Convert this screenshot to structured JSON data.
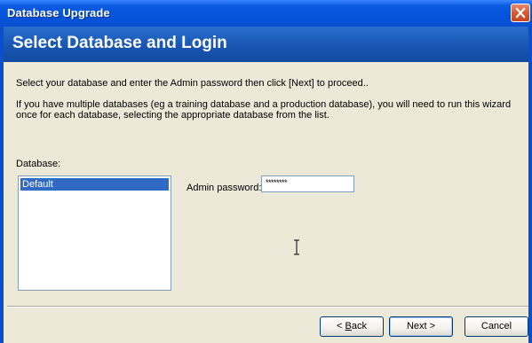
{
  "window": {
    "title": "Database Upgrade"
  },
  "banner": {
    "heading": "Select Database and Login"
  },
  "content": {
    "instruction": "Select your database and enter the Admin password then click [Next] to proceed..",
    "note": "If you have multiple databases (eg a training database and a production database), you will need to run this wizard once for each database, selecting the appropriate database from the list.",
    "database_label": "Database:",
    "databases": [
      "Default"
    ],
    "password_label": "Admin password:",
    "password_value": "********"
  },
  "buttons": {
    "back_prefix": "< ",
    "back_hotkey": "B",
    "back_rest": "ack",
    "next": "Next >",
    "cancel": "Cancel"
  },
  "colors": {
    "titlebar": "#0353dc",
    "banner": "#1856b3",
    "selection": "#316ac5",
    "face": "#ece9d8"
  }
}
